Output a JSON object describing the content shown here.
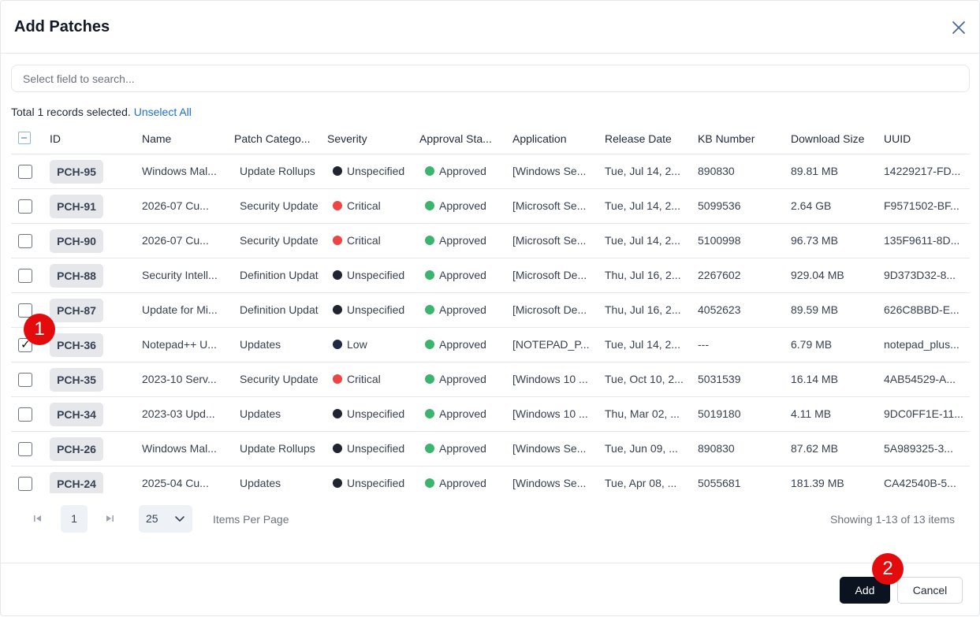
{
  "modal": {
    "title": "Add Patches"
  },
  "search": {
    "placeholder": "Select field to search..."
  },
  "selection": {
    "text": "Total 1 records selected.",
    "unselect_label": "Unselect All"
  },
  "columns": [
    "ID",
    "Name",
    "Patch Catego...",
    "Severity",
    "Approval Sta...",
    "Application",
    "Release Date",
    "KB Number",
    "Download Size",
    "UUID"
  ],
  "severity_colors": {
    "Unspecified": "#1f2430",
    "Critical": "#ef4444",
    "Low": "#1e2a44"
  },
  "approval_color": "#3bb46e",
  "rows": [
    {
      "checked": false,
      "id": "PCH-95",
      "name": "Windows Mal...",
      "category": "Update Rollups",
      "severity": "Unspecified",
      "approval": "Approved",
      "application": "[Windows Se...",
      "release": "Tue, Jul 14, 2...",
      "kb": "890830",
      "size": "89.81 MB",
      "uuid": "14229217-FD..."
    },
    {
      "checked": false,
      "id": "PCH-91",
      "name": "2026-07 Cu...",
      "category": "Security Update",
      "severity": "Critical",
      "approval": "Approved",
      "application": "[Microsoft Se...",
      "release": "Tue, Jul 14, 2...",
      "kb": "5099536",
      "size": "2.64 GB",
      "uuid": "F9571502-BF..."
    },
    {
      "checked": false,
      "id": "PCH-90",
      "name": "2026-07 Cu...",
      "category": "Security Update",
      "severity": "Critical",
      "approval": "Approved",
      "application": "[Microsoft Se...",
      "release": "Tue, Jul 14, 2...",
      "kb": "5100998",
      "size": "96.73 MB",
      "uuid": "135F9611-8D..."
    },
    {
      "checked": false,
      "id": "PCH-88",
      "name": "Security Intell...",
      "category": "Definition Updat",
      "severity": "Unspecified",
      "approval": "Approved",
      "application": "[Microsoft De...",
      "release": "Thu, Jul 16, 2...",
      "kb": "2267602",
      "size": "929.04 MB",
      "uuid": "9D373D32-8..."
    },
    {
      "checked": false,
      "id": "PCH-87",
      "name": "Update for Mi...",
      "category": "Definition Updat",
      "severity": "Unspecified",
      "approval": "Approved",
      "application": "[Microsoft De...",
      "release": "Thu, Jul 16, 2...",
      "kb": "4052623",
      "size": "89.59 MB",
      "uuid": "626C8BBD-E..."
    },
    {
      "checked": true,
      "id": "PCH-36",
      "name": "Notepad++ U...",
      "category": "Updates",
      "severity": "Low",
      "approval": "Approved",
      "application": "[NOTEPAD_P...",
      "release": "Tue, Jul 14, 2...",
      "kb": "---",
      "size": "6.79 MB",
      "uuid": "notepad_plus..."
    },
    {
      "checked": false,
      "id": "PCH-35",
      "name": "2023-10 Serv...",
      "category": "Security Update",
      "severity": "Critical",
      "approval": "Approved",
      "application": "[Windows 10 ...",
      "release": "Tue, Oct 10, 2...",
      "kb": "5031539",
      "size": "16.14 MB",
      "uuid": "4AB54529-A..."
    },
    {
      "checked": false,
      "id": "PCH-34",
      "name": "2023-03 Upd...",
      "category": "Updates",
      "severity": "Unspecified",
      "approval": "Approved",
      "application": "[Windows 10 ...",
      "release": "Thu, Mar 02, ...",
      "kb": "5019180",
      "size": "4.11 MB",
      "uuid": "9DC0FF1E-11..."
    },
    {
      "checked": false,
      "id": "PCH-26",
      "name": "Windows Mal...",
      "category": "Update Rollups",
      "severity": "Unspecified",
      "approval": "Approved",
      "application": "[Windows Se...",
      "release": "Tue, Jun 09, ...",
      "kb": "890830",
      "size": "87.62 MB",
      "uuid": "5A989325-3..."
    },
    {
      "checked": false,
      "id": "PCH-24",
      "name": "2025-04 Cu...",
      "category": "Updates",
      "severity": "Unspecified",
      "approval": "Approved",
      "application": "[Windows Se...",
      "release": "Tue, Apr 08, ...",
      "kb": "5055681",
      "size": "181.39 MB",
      "uuid": "CA42540B-5..."
    }
  ],
  "pagination": {
    "current_page": "1",
    "page_size": "25",
    "items_per_page_label": "Items Per Page",
    "showing": "Showing 1-13 of 13 items"
  },
  "footer": {
    "add_label": "Add",
    "cancel_label": "Cancel"
  },
  "markers": [
    "1",
    "2"
  ]
}
